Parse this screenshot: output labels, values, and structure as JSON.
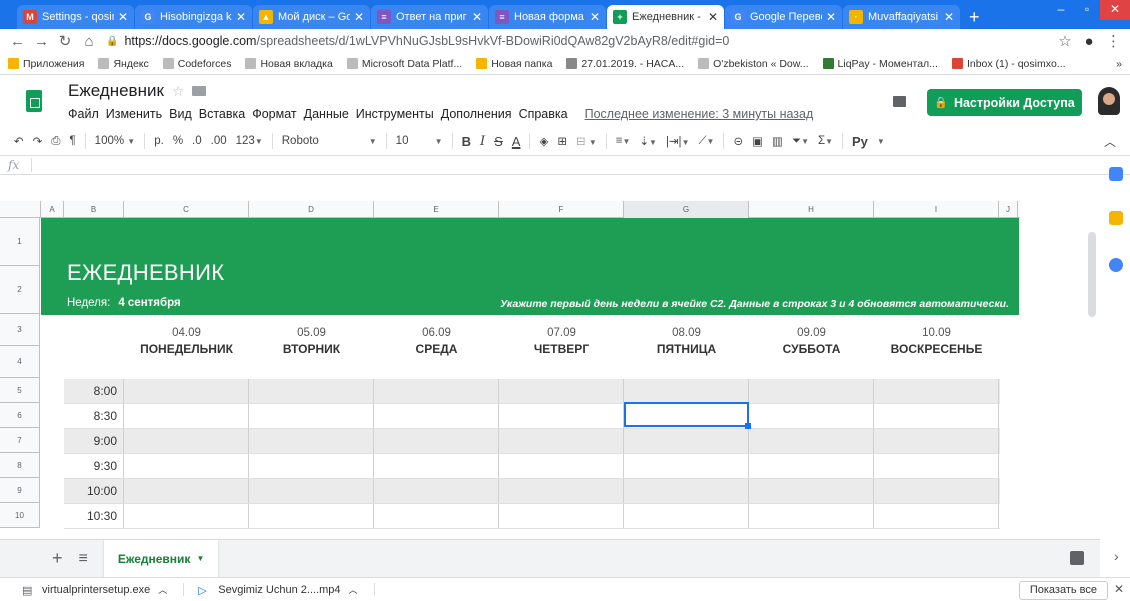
{
  "browser": {
    "tabs": [
      {
        "title": "Settings - qosim",
        "color": "#db4437",
        "glyph": "M"
      },
      {
        "title": "Hisobingizga k",
        "color": "#4285f4",
        "glyph": "G"
      },
      {
        "title": "Мой диск – Go",
        "color": "#f4b400",
        "glyph": "▲"
      },
      {
        "title": "Ответ на приг",
        "color": "#7e57c2",
        "glyph": "≡"
      },
      {
        "title": "Новая форма",
        "color": "#7e57c2",
        "glyph": "≡"
      },
      {
        "title": "Ежедневник - ",
        "color": "#0f9d58",
        "glyph": "+"
      },
      {
        "title": "Google Перево",
        "color": "#4285f4",
        "glyph": "G"
      },
      {
        "title": "Muvaffaqiyatsi",
        "color": "#f4b400",
        "glyph": "·"
      }
    ],
    "url_host": "https://docs.google.com",
    "url_path": "/spreadsheets/d/1wLVPVhNuGJsbL9sHvkVf-BDowiRi0dQAw82gV2bAyR8/edit#gid=0",
    "bookmarks": [
      "Приложения",
      "Яндекс",
      "Codeforces",
      "Новая вкладка",
      "Microsoft Data Platf...",
      "Новая папка",
      "27.01.2019. - HACA...",
      "O'zbekiston « Dow...",
      "LiqPay - Моментал...",
      "Inbox (1) - qosimxo..."
    ]
  },
  "doc": {
    "title": "Ежедневник",
    "menus": [
      "Файл",
      "Изменить",
      "Вид",
      "Вставка",
      "Формат",
      "Данные",
      "Инструменты",
      "Дополнения",
      "Справка"
    ],
    "last_edit": "Последнее изменение: 3 минуты назад",
    "share_label": "Настройки Доступа"
  },
  "toolbar": {
    "zoom": "100%",
    "currency": "р.",
    "percent": "%",
    "dec_less": ".0",
    "dec_more": ".00",
    "format": "123",
    "font": "Roboto",
    "size": "10",
    "input_tool": "Ру"
  },
  "formula_label": "fx",
  "columns": [
    {
      "label": "A",
      "w": 23
    },
    {
      "label": "B",
      "w": 60
    },
    {
      "label": "C",
      "w": 125
    },
    {
      "label": "D",
      "w": 125
    },
    {
      "label": "E",
      "w": 125
    },
    {
      "label": "F",
      "w": 125
    },
    {
      "label": "G",
      "w": 125
    },
    {
      "label": "H",
      "w": 125
    },
    {
      "label": "I",
      "w": 125
    },
    {
      "label": "J",
      "w": 19
    }
  ],
  "rows": [
    "1",
    "2",
    "3",
    "4",
    "5",
    "6",
    "7",
    "8",
    "9",
    "10"
  ],
  "planner": {
    "title": "ЕЖЕДНЕВНИК",
    "week_label": "Неделя:",
    "week_value": "4 сентября",
    "hint": "Укажите первый день недели в ячейке C2. Данные в строках 3 и 4 обновятся автоматически.",
    "days": [
      {
        "date": "04.09",
        "name": "ПОНЕДЕЛЬНИК"
      },
      {
        "date": "05.09",
        "name": "ВТОРНИК"
      },
      {
        "date": "06.09",
        "name": "СРЕДА"
      },
      {
        "date": "07.09",
        "name": "ЧЕТВЕРГ"
      },
      {
        "date": "08.09",
        "name": "ПЯТНИЦА"
      },
      {
        "date": "09.09",
        "name": "СУББОТА"
      },
      {
        "date": "10.09",
        "name": "ВОСКРЕСЕНЬЕ"
      }
    ],
    "times": [
      "8:00",
      "8:30",
      "9:00",
      "9:30",
      "10:00",
      "10:30"
    ]
  },
  "sheet_tab": "Ежедневник",
  "downloads": [
    {
      "name": "virtualprintersetup.exe"
    },
    {
      "name": "Sevgimiz Uchun 2....mp4"
    }
  ],
  "show_all": "Показать все"
}
